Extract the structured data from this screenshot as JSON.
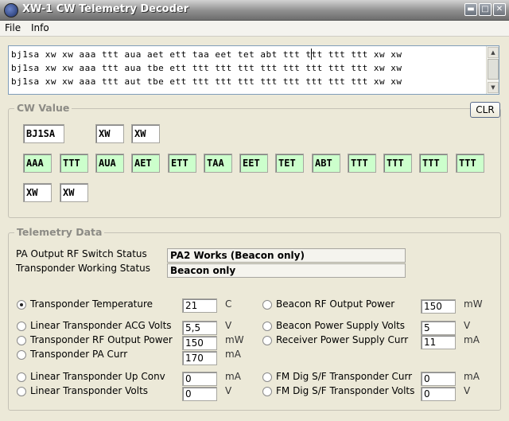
{
  "window": {
    "title": "XW-1 CW Telemetry Decoder",
    "controls": [
      "minimize-icon",
      "maximize-icon",
      "close-icon"
    ]
  },
  "menu": {
    "file": "File",
    "info": "Info"
  },
  "raw_lines": [
    "bj1sa xw xw aaa ttt aua aet ett taa eet tet abt ttt ttt ttt ttt xw xw",
    "bj1sa xw xw aaa ttt aua tbe ett ttt ttt ttt ttt ttt ttt ttt ttt xw xw",
    "bj1sa xw xw aaa ttt aut tbe ett ttt ttt ttt ttt ttt ttt ttt ttt xw xw"
  ],
  "cw_value": {
    "title": "CW Value",
    "clr_label": "CLR",
    "row1": [
      "BJ1SA",
      "XW",
      "XW"
    ],
    "row2": [
      "AAA",
      "TTT",
      "AUA",
      "AET",
      "ETT",
      "TAA",
      "EET",
      "TET",
      "ABT",
      "TTT",
      "TTT",
      "TTT",
      "TTT"
    ],
    "row3": [
      "XW",
      "XW"
    ]
  },
  "telemetry": {
    "title": "Telemetry Data",
    "status_rows": [
      {
        "label": "PA Output RF Switch Status",
        "value": "PA2 Works (Beacon only)"
      },
      {
        "label": "Transponder Working Status",
        "value": "Beacon only"
      }
    ],
    "left_params": [
      {
        "label": "Transponder Temperature",
        "value": "21",
        "unit": "C",
        "selected": true
      },
      {
        "label": "Linear Transponder ACG Volts",
        "value": "5,5",
        "unit": "V",
        "selected": false
      },
      {
        "label": "Transponder RF Output Power",
        "value": "150",
        "unit": "mW",
        "selected": false
      },
      {
        "label": "Transponder PA Curr",
        "value": "170",
        "unit": "mA",
        "selected": false
      },
      {
        "label": "Linear Transponder Up Conv",
        "value": "0",
        "unit": "mA",
        "selected": false
      },
      {
        "label": "Linear Transponder Volts",
        "value": "0",
        "unit": "V",
        "selected": false
      }
    ],
    "right_params": [
      {
        "label": "Beacon RF Output Power",
        "value": "150",
        "unit": "mW",
        "selected": false
      },
      {
        "label": "Beacon Power Supply Volts",
        "value": "5",
        "unit": "V",
        "selected": false
      },
      {
        "label": "Receiver Power Supply Curr",
        "value": "11",
        "unit": "mA",
        "selected": false
      },
      {
        "label": "FM Dig S/F Transponder Curr",
        "value": "0",
        "unit": "mA",
        "selected": false
      },
      {
        "label": "FM Dig S/F Transponder Volts",
        "value": "0",
        "unit": "V",
        "selected": false
      }
    ]
  }
}
